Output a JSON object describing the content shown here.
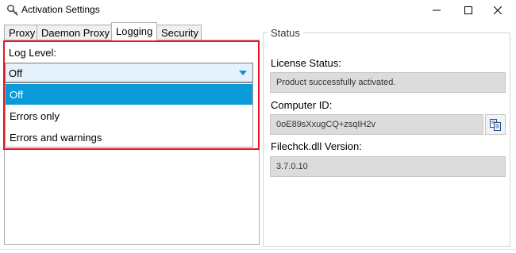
{
  "window": {
    "title": "Activation Settings",
    "icon": "key-search-icon",
    "controls": [
      "minimize-icon",
      "maximize-icon",
      "close-icon"
    ]
  },
  "tabs": [
    {
      "label": "Proxy",
      "active": false
    },
    {
      "label": "Daemon Proxy",
      "active": false
    },
    {
      "label": "Logging",
      "active": true
    },
    {
      "label": "Security",
      "active": false
    }
  ],
  "logging": {
    "log_level_label": "Log Level:",
    "selected_value": "Off",
    "options": [
      "Off",
      "Errors only",
      "Errors and warnings"
    ]
  },
  "status": {
    "group_title": "Status",
    "license_label": "License Status:",
    "license_value": "Product successfully activated.",
    "computer_id_label": "Computer ID:",
    "computer_id_value": "0oE89sXxugCQ+zsqIH2v",
    "filechck_label": "Filechck.dll Version:",
    "filechck_value": "3.7.0.10",
    "copy_icon": "copy-icon"
  },
  "colors": {
    "highlight": "#e8141e",
    "selected_item": "#0b9ad8",
    "combo_background": "#e5f1fb",
    "field_background": "#dcdcdc"
  }
}
